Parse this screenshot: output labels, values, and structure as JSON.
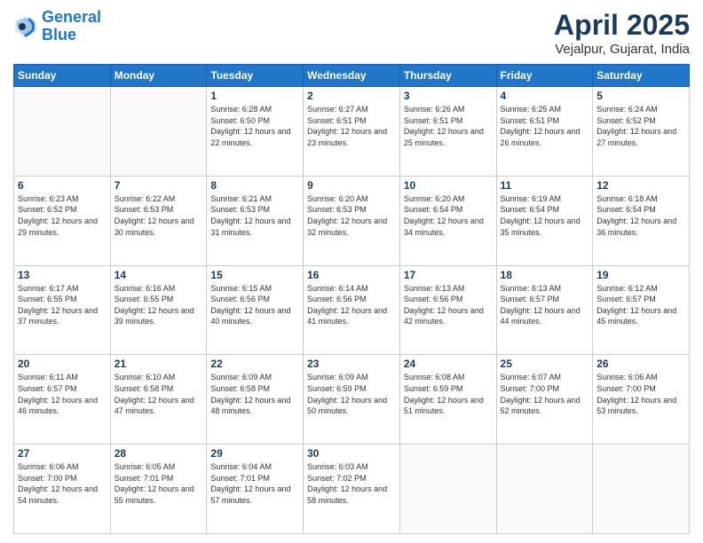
{
  "logo": {
    "line1": "General",
    "line2": "Blue"
  },
  "title": "April 2025",
  "subtitle": "Vejalpur, Gujarat, India",
  "weekdays": [
    "Sunday",
    "Monday",
    "Tuesday",
    "Wednesday",
    "Thursday",
    "Friday",
    "Saturday"
  ],
  "weeks": [
    [
      {
        "day": "",
        "sunrise": "",
        "sunset": "",
        "daylight": ""
      },
      {
        "day": "",
        "sunrise": "",
        "sunset": "",
        "daylight": ""
      },
      {
        "day": "1",
        "sunrise": "Sunrise: 6:28 AM",
        "sunset": "Sunset: 6:50 PM",
        "daylight": "Daylight: 12 hours and 22 minutes."
      },
      {
        "day": "2",
        "sunrise": "Sunrise: 6:27 AM",
        "sunset": "Sunset: 6:51 PM",
        "daylight": "Daylight: 12 hours and 23 minutes."
      },
      {
        "day": "3",
        "sunrise": "Sunrise: 6:26 AM",
        "sunset": "Sunset: 6:51 PM",
        "daylight": "Daylight: 12 hours and 25 minutes."
      },
      {
        "day": "4",
        "sunrise": "Sunrise: 6:25 AM",
        "sunset": "Sunset: 6:51 PM",
        "daylight": "Daylight: 12 hours and 26 minutes."
      },
      {
        "day": "5",
        "sunrise": "Sunrise: 6:24 AM",
        "sunset": "Sunset: 6:52 PM",
        "daylight": "Daylight: 12 hours and 27 minutes."
      }
    ],
    [
      {
        "day": "6",
        "sunrise": "Sunrise: 6:23 AM",
        "sunset": "Sunset: 6:52 PM",
        "daylight": "Daylight: 12 hours and 29 minutes."
      },
      {
        "day": "7",
        "sunrise": "Sunrise: 6:22 AM",
        "sunset": "Sunset: 6:53 PM",
        "daylight": "Daylight: 12 hours and 30 minutes."
      },
      {
        "day": "8",
        "sunrise": "Sunrise: 6:21 AM",
        "sunset": "Sunset: 6:53 PM",
        "daylight": "Daylight: 12 hours and 31 minutes."
      },
      {
        "day": "9",
        "sunrise": "Sunrise: 6:20 AM",
        "sunset": "Sunset: 6:53 PM",
        "daylight": "Daylight: 12 hours and 32 minutes."
      },
      {
        "day": "10",
        "sunrise": "Sunrise: 6:20 AM",
        "sunset": "Sunset: 6:54 PM",
        "daylight": "Daylight: 12 hours and 34 minutes."
      },
      {
        "day": "11",
        "sunrise": "Sunrise: 6:19 AM",
        "sunset": "Sunset: 6:54 PM",
        "daylight": "Daylight: 12 hours and 35 minutes."
      },
      {
        "day": "12",
        "sunrise": "Sunrise: 6:18 AM",
        "sunset": "Sunset: 6:54 PM",
        "daylight": "Daylight: 12 hours and 36 minutes."
      }
    ],
    [
      {
        "day": "13",
        "sunrise": "Sunrise: 6:17 AM",
        "sunset": "Sunset: 6:55 PM",
        "daylight": "Daylight: 12 hours and 37 minutes."
      },
      {
        "day": "14",
        "sunrise": "Sunrise: 6:16 AM",
        "sunset": "Sunset: 6:55 PM",
        "daylight": "Daylight: 12 hours and 39 minutes."
      },
      {
        "day": "15",
        "sunrise": "Sunrise: 6:15 AM",
        "sunset": "Sunset: 6:56 PM",
        "daylight": "Daylight: 12 hours and 40 minutes."
      },
      {
        "day": "16",
        "sunrise": "Sunrise: 6:14 AM",
        "sunset": "Sunset: 6:56 PM",
        "daylight": "Daylight: 12 hours and 41 minutes."
      },
      {
        "day": "17",
        "sunrise": "Sunrise: 6:13 AM",
        "sunset": "Sunset: 6:56 PM",
        "daylight": "Daylight: 12 hours and 42 minutes."
      },
      {
        "day": "18",
        "sunrise": "Sunrise: 6:13 AM",
        "sunset": "Sunset: 6:57 PM",
        "daylight": "Daylight: 12 hours and 44 minutes."
      },
      {
        "day": "19",
        "sunrise": "Sunrise: 6:12 AM",
        "sunset": "Sunset: 6:57 PM",
        "daylight": "Daylight: 12 hours and 45 minutes."
      }
    ],
    [
      {
        "day": "20",
        "sunrise": "Sunrise: 6:11 AM",
        "sunset": "Sunset: 6:57 PM",
        "daylight": "Daylight: 12 hours and 46 minutes."
      },
      {
        "day": "21",
        "sunrise": "Sunrise: 6:10 AM",
        "sunset": "Sunset: 6:58 PM",
        "daylight": "Daylight: 12 hours and 47 minutes."
      },
      {
        "day": "22",
        "sunrise": "Sunrise: 6:09 AM",
        "sunset": "Sunset: 6:58 PM",
        "daylight": "Daylight: 12 hours and 48 minutes."
      },
      {
        "day": "23",
        "sunrise": "Sunrise: 6:09 AM",
        "sunset": "Sunset: 6:59 PM",
        "daylight": "Daylight: 12 hours and 50 minutes."
      },
      {
        "day": "24",
        "sunrise": "Sunrise: 6:08 AM",
        "sunset": "Sunset: 6:59 PM",
        "daylight": "Daylight: 12 hours and 51 minutes."
      },
      {
        "day": "25",
        "sunrise": "Sunrise: 6:07 AM",
        "sunset": "Sunset: 7:00 PM",
        "daylight": "Daylight: 12 hours and 52 minutes."
      },
      {
        "day": "26",
        "sunrise": "Sunrise: 6:06 AM",
        "sunset": "Sunset: 7:00 PM",
        "daylight": "Daylight: 12 hours and 53 minutes."
      }
    ],
    [
      {
        "day": "27",
        "sunrise": "Sunrise: 6:06 AM",
        "sunset": "Sunset: 7:00 PM",
        "daylight": "Daylight: 12 hours and 54 minutes."
      },
      {
        "day": "28",
        "sunrise": "Sunrise: 6:05 AM",
        "sunset": "Sunset: 7:01 PM",
        "daylight": "Daylight: 12 hours and 55 minutes."
      },
      {
        "day": "29",
        "sunrise": "Sunrise: 6:04 AM",
        "sunset": "Sunset: 7:01 PM",
        "daylight": "Daylight: 12 hours and 57 minutes."
      },
      {
        "day": "30",
        "sunrise": "Sunrise: 6:03 AM",
        "sunset": "Sunset: 7:02 PM",
        "daylight": "Daylight: 12 hours and 58 minutes."
      },
      {
        "day": "",
        "sunrise": "",
        "sunset": "",
        "daylight": ""
      },
      {
        "day": "",
        "sunrise": "",
        "sunset": "",
        "daylight": ""
      },
      {
        "day": "",
        "sunrise": "",
        "sunset": "",
        "daylight": ""
      }
    ]
  ]
}
